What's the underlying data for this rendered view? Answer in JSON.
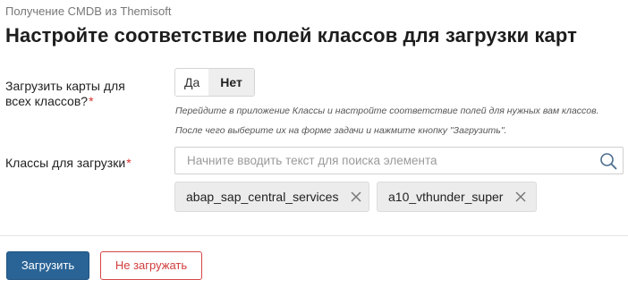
{
  "breadcrumb": "Получение CMDB из Themisoft",
  "title": "Настройте соответствие полей классов для загрузки карт",
  "load_cards": {
    "label": "Загрузить карты для всех классов?",
    "required_mark": "*",
    "options": [
      "Да",
      "Нет"
    ],
    "selected": "Нет"
  },
  "hints": [
    "Перейдите в приложение Классы и настройте соответствие полей для нужных вам классов.",
    "После чего выберите их на форме задачи и нажмите кнопку \"Загрузить\"."
  ],
  "classes": {
    "label": "Классы для загрузки",
    "required_mark": "*",
    "placeholder": "Начните вводить текст для поиска элемента",
    "value": "",
    "selected": [
      "abap_sap_central_services",
      "a10_vthunder_super"
    ]
  },
  "buttons": {
    "load": "Загрузить",
    "skip": "Не загружать"
  },
  "icons": {
    "search": "search-icon",
    "chip_remove": "close-icon"
  },
  "colors": {
    "primary": "#2a6496",
    "danger": "#d13c3c",
    "required": "#d83232"
  }
}
